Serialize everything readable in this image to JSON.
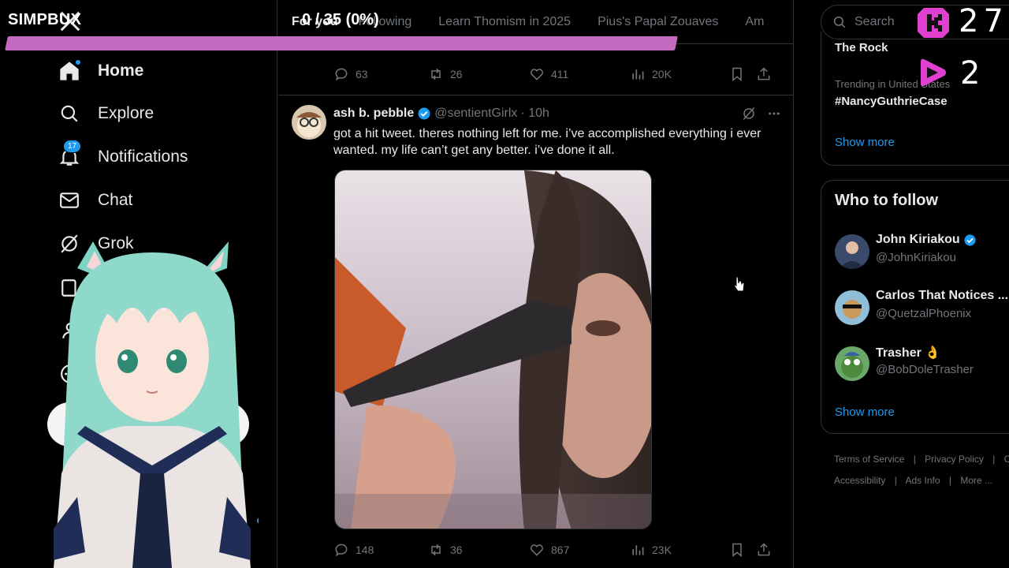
{
  "overlay": {
    "brand": "SIMPBUX",
    "progress_text": "0 / 35 (0%)",
    "progress_fraction": 0.0,
    "bar_color": "#c56ac1",
    "counter_k": "27",
    "counter_p": "2"
  },
  "nav": {
    "items": [
      {
        "label": "Home"
      },
      {
        "label": "Explore"
      },
      {
        "label": "Notifications",
        "badge": "17"
      },
      {
        "label": "Chat"
      },
      {
        "label": "Grok"
      }
    ]
  },
  "tabs": [
    "For you",
    "Following",
    "Learn Thomism in 2025",
    "Pius's Papal Zouaves",
    "Am"
  ],
  "prev_tweet": {
    "replies": "63",
    "reposts": "26",
    "likes": "411",
    "views": "20K"
  },
  "tweet": {
    "name": "ash b. pebble",
    "handle": "@sentientGirlx",
    "time": "· 10h",
    "text": "got a hit tweet. theres nothing left for me. i’ve accomplished everything i ever wanted. my life can’t get any better. i’ve done it all.",
    "replies": "148",
    "reposts": "36",
    "likes": "867",
    "views": "23K"
  },
  "right": {
    "search_placeholder": "Search",
    "trend_top": "The Rock",
    "trend_context": "Trending in United States",
    "trend_tag": "#NancyGuthrieCase",
    "show_more_1": "Show more",
    "who_title": "Who to follow",
    "follow": [
      {
        "name": "John Kiriakou",
        "handle": "@JohnKiriakou"
      },
      {
        "name": "Carlos That Notices ...",
        "handle": "@QuetzalPhoenix"
      },
      {
        "name": "Trasher 👌",
        "handle": "@BobDoleTrasher"
      }
    ],
    "show_more_2": "Show more",
    "footer_1": [
      "Terms of Service",
      "Privacy Policy",
      "C"
    ],
    "footer_2": [
      "Accessibility",
      "Ads Info",
      "More ..."
    ]
  },
  "colors": {
    "accent": "#1d9bf0",
    "border": "#2f3336",
    "muted": "#71767b"
  }
}
